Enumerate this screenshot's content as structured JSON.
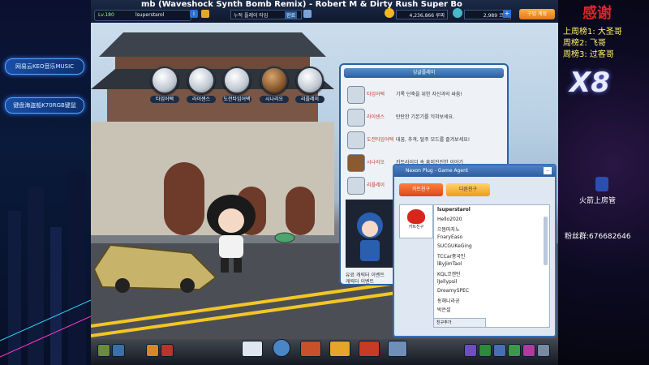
{
  "song_ticker": "mb (Waveshock Synth Bomb Remix) - Robert M & Dirty Rush     Super Bo",
  "top_bar": {
    "level": "Lv.180",
    "username": "lsuperstarol",
    "mission_text": "누적 플레이 타임",
    "mission_button": "완료",
    "lucci_amount": "4,236,866 루찌",
    "coin_amount": "2,989 코인",
    "buy_button": "구입 계정"
  },
  "mode_menu": [
    {
      "label": "타임어택",
      "icon": "stopwatch-icon"
    },
    {
      "label": "라이센스",
      "icon": "license-icon"
    },
    {
      "label": "도전타임어택",
      "icon": "fist-icon"
    },
    {
      "label": "시나리오",
      "icon": "book-icon"
    },
    {
      "label": "리플레이",
      "icon": "replay-camera-icon"
    }
  ],
  "single_panel": {
    "title": "싱글플레이",
    "rows": [
      {
        "name": "타임어택",
        "desc": "기록 단축을 위한 자신과의 싸움!",
        "icon": "stopwatch-icon"
      },
      {
        "name": "라이센스",
        "desc": "탄탄한 기본기를 익혀보세요.",
        "icon": "license-icon"
      },
      {
        "name": "도전타임어택",
        "desc": "대꿈, 추격, 탈주 모드를 즐겨보세요!",
        "icon": "fist-icon"
      },
      {
        "name": "시나리오",
        "desc": "카트라이더 속 흥미진진한 이야기",
        "icon": "book-icon"
      },
      {
        "name": "리플레이",
        "desc": "",
        "icon": "replay-camera-icon"
      }
    ],
    "footer_label": "유료 캐릭터 이벤트",
    "footer_sub": "캐릭터 이벤트"
  },
  "plug": {
    "title": "Nexon Plug - Game Agent",
    "tab_cart": "카트친구",
    "tab_other": "다른친구",
    "avatar_label": "카트친구",
    "self_name": "lsuperstarol",
    "friends": [
      "Hello2020",
      "으뜸마자노",
      "FnaryEaso",
      "SUCGUKeGing",
      "TCCar중국인",
      "lByJimTaol",
      "KQL코겐틴",
      "lJellypsil",
      "DreamySPEC",
      "동해니라공",
      "박은설"
    ],
    "add_friend_label": "친구추가"
  },
  "left_overlay": {
    "pill1": "网易云KEO音乐MUSIC",
    "pill2": "键盘海盗船K70RGB键鼠"
  },
  "right_overlay": {
    "thanks_title": "感谢",
    "rank1": "上周榜1: 大圣哥",
    "rank2": "周榜2: 飞哥",
    "rank3": "周榜3: 过客哥",
    "logo": "X8",
    "badge_text": "火箭上房管",
    "fans_text": "粉丝群:676682646"
  },
  "colors": {
    "accent_blue": "#2d5f9e",
    "lucci_gold": "#f2b71f",
    "thanks_red": "#d8262c",
    "rank_yellow": "#fff36b"
  }
}
